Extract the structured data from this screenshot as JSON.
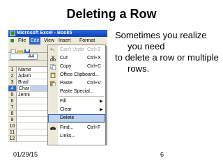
{
  "slide": {
    "title": "Deleting a Row",
    "body_line_1": "Sometimes you realize you need",
    "body_line_2": "to delete a row or multiple rows.",
    "footer_date": "01/29/15",
    "page_number": "6"
  },
  "excel": {
    "window_title": "Microsoft Excel - Book5",
    "menubar": [
      "File",
      "Edit",
      "View",
      "Insert",
      "Format"
    ],
    "active_menu": "Edit",
    "name_box": "A4",
    "row_numbers": [
      "1",
      "2",
      "3",
      "4",
      "5",
      "6",
      "7",
      "8",
      "9",
      "10",
      "11",
      "12"
    ],
    "cells": [
      "Name",
      "Adam",
      "Brad",
      "Char",
      "Jenni",
      "",
      "",
      "",
      "",
      "",
      "",
      ""
    ],
    "selected_row": "4",
    "edit_menu": [
      {
        "label": "Can't Undo",
        "shortcut": "Ctrl+Z",
        "icon": "undo-icon",
        "disabled": true
      },
      {
        "label": "Cut",
        "shortcut": "Ctrl+X",
        "icon": "scissors-icon"
      },
      {
        "label": "Copy",
        "shortcut": "Ctrl+C",
        "icon": "copy-icon"
      },
      {
        "label": "Office Clipboard...",
        "shortcut": "",
        "icon": "clipboard-icon"
      },
      {
        "label": "Paste",
        "shortcut": "Ctrl+V",
        "icon": "paste-icon"
      },
      {
        "label": "Paste Special...",
        "shortcut": "",
        "icon": ""
      },
      {
        "label": "Fill",
        "shortcut": "",
        "icon": "",
        "submenu": true
      },
      {
        "label": "Clear",
        "shortcut": "",
        "icon": "",
        "submenu": true
      },
      {
        "label": "Delete",
        "shortcut": "",
        "icon": "",
        "highlighted": true
      },
      {
        "label": "Find...",
        "shortcut": "Ctrl+F",
        "icon": "binoculars-icon"
      },
      {
        "label": "Links...",
        "shortcut": "",
        "icon": ""
      }
    ],
    "colors": {
      "titlebar": "#0a3fb8",
      "selection": "#316ac5",
      "menu_highlight": "#c1d2ee",
      "chrome": "#ece9d8"
    }
  }
}
